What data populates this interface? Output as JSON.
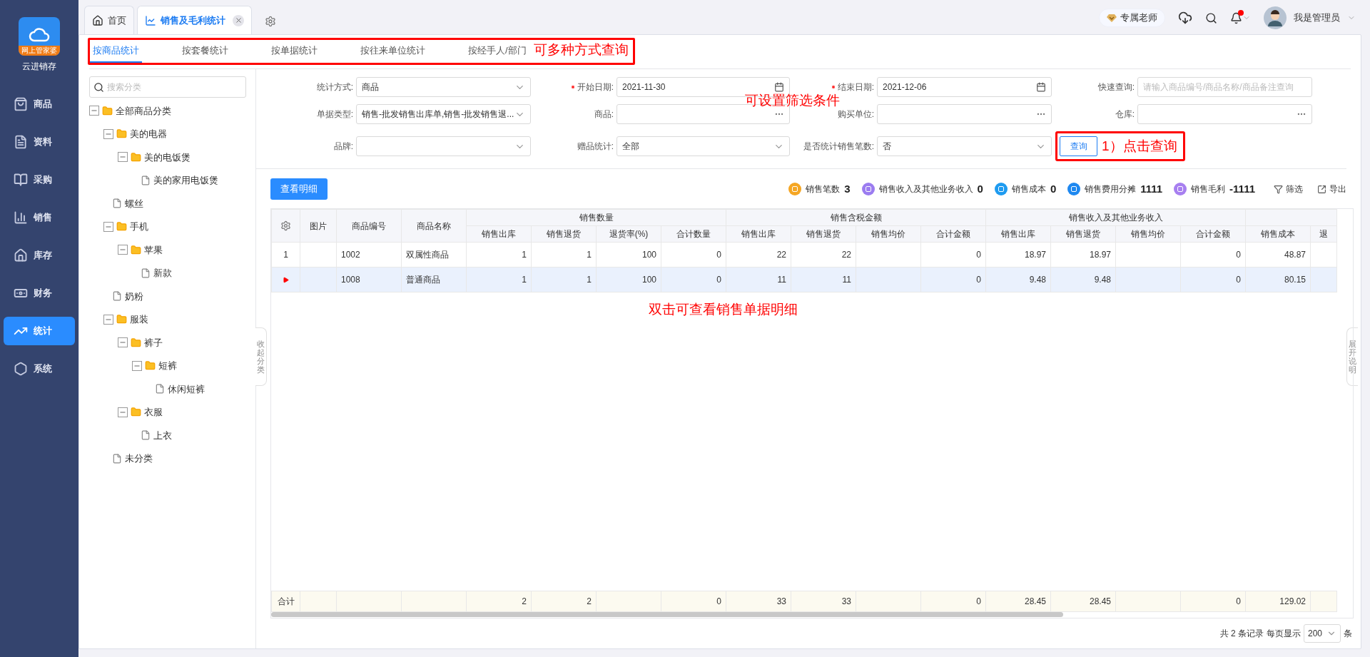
{
  "sidebar": {
    "logo_badge": "网上管家婆",
    "app_name": "云进销存",
    "items": [
      {
        "label": "商品",
        "selected": false
      },
      {
        "label": "资料",
        "selected": false
      },
      {
        "label": "采购",
        "selected": false
      },
      {
        "label": "销售",
        "selected": false
      },
      {
        "label": "库存",
        "selected": false
      },
      {
        "label": "财务",
        "selected": false
      },
      {
        "label": "统计",
        "selected": true
      },
      {
        "label": "系统",
        "selected": false
      }
    ]
  },
  "tabs": [
    {
      "label": "首页",
      "selected": false,
      "closable": false
    },
    {
      "label": "销售及毛利统计",
      "selected": true,
      "closable": true
    }
  ],
  "header": {
    "teacher": "专属老师",
    "user": "我是管理员",
    "has_notification": true
  },
  "sub_tabs": [
    {
      "label": "按商品统计",
      "selected": true
    },
    {
      "label": "按套餐统计",
      "selected": false
    },
    {
      "label": "按单据统计",
      "selected": false
    },
    {
      "label": "按往来单位统计",
      "selected": false
    },
    {
      "label": "按经手人/部门",
      "selected": false
    }
  ],
  "annotations": {
    "tabs_note": "可多种方式查询",
    "filter_note": "可设置筛选条件",
    "query_note": "1）点击查询",
    "table_note": "双击可查看销售单据明细"
  },
  "tree": {
    "placeholder": "搜索分类",
    "collapse_label": "收起分类",
    "nodes": [
      {
        "label": "全部商品分类",
        "kind": "folder",
        "expanded": true,
        "children": [
          {
            "label": "美的电器",
            "kind": "folder",
            "expanded": true,
            "children": [
              {
                "label": "美的电饭煲",
                "kind": "folder",
                "expanded": true,
                "children": [
                  {
                    "label": "美的家用电饭煲",
                    "kind": "file"
                  }
                ]
              }
            ]
          },
          {
            "label": "螺丝",
            "kind": "file"
          },
          {
            "label": "手机",
            "kind": "folder",
            "expanded": true,
            "children": [
              {
                "label": "苹果",
                "kind": "folder",
                "expanded": true,
                "children": [
                  {
                    "label": "新款",
                    "kind": "file"
                  }
                ]
              }
            ]
          },
          {
            "label": "奶粉",
            "kind": "file"
          },
          {
            "label": "服装",
            "kind": "folder",
            "expanded": true,
            "children": [
              {
                "label": "裤子",
                "kind": "folder",
                "expanded": true,
                "children": [
                  {
                    "label": "短裤",
                    "kind": "folder",
                    "expanded": true,
                    "children": [
                      {
                        "label": "休闲短裤",
                        "kind": "file"
                      }
                    ]
                  }
                ]
              },
              {
                "label": "衣服",
                "kind": "folder",
                "expanded": true,
                "children": [
                  {
                    "label": "上衣",
                    "kind": "file"
                  }
                ]
              }
            ]
          },
          {
            "label": "未分类",
            "kind": "file"
          }
        ]
      }
    ]
  },
  "filters": [
    [
      {
        "label": "统计方式:",
        "kind": "select",
        "value": "商品"
      },
      {
        "label": "开始日期:",
        "kind": "date",
        "value": "2021-11-30",
        "required": true
      },
      {
        "label": "结束日期:",
        "kind": "date",
        "value": "2021-12-06",
        "required": true
      },
      {
        "label": "快速查询:",
        "kind": "text",
        "placeholder": "请输入商品编号/商品名称/商品备注查询"
      }
    ],
    [
      {
        "label": "单据类型:",
        "kind": "select",
        "value": "销售-批发销售出库单,销售-批发销售退..."
      },
      {
        "label": "商品:",
        "kind": "picker"
      },
      {
        "label": "购买单位:",
        "kind": "picker"
      },
      {
        "label": "仓库:",
        "kind": "picker"
      }
    ],
    [
      {
        "label": "品牌:",
        "kind": "select"
      },
      {
        "label": "赠品统计:",
        "kind": "select",
        "value": "全部"
      },
      {
        "label": "是否统计销售笔数:",
        "kind": "select",
        "value": "否"
      }
    ]
  ],
  "query_button": "查询",
  "detail_button": "查看明细",
  "stats": [
    {
      "label": "销售笔数",
      "value": "3",
      "color": "#f5a623"
    },
    {
      "label": "销售收入及其他业务收入",
      "value": "0",
      "color": "#9b7cf0"
    },
    {
      "label": "销售成本",
      "value": "0",
      "color": "#1e9bf0"
    },
    {
      "label": "销售费用分摊",
      "value": "1111",
      "color": "#1e88f0"
    },
    {
      "label": "销售毛利",
      "value": "-1111",
      "color": "#a77ff0"
    }
  ],
  "tools": [
    "筛选",
    "导出"
  ],
  "table": {
    "groups": [
      "销售数量",
      "销售含税金额",
      "销售收入及其他业务收入"
    ],
    "columns": [
      "图片",
      "商品编号",
      "商品名称",
      "销售出库",
      "销售退货",
      "退货率(%)",
      "合计数量",
      "销售出库",
      "销售退货",
      "销售均价",
      "合计金额",
      "销售出库",
      "销售退货",
      "销售均价",
      "合计金额",
      "销售成本",
      "退"
    ],
    "rows": [
      {
        "index": "1",
        "selected": false,
        "cells": [
          "",
          "1002",
          "双属性商品",
          "1",
          "1",
          "100",
          "0",
          "22",
          "22",
          "",
          "0",
          "18.97",
          "18.97",
          "",
          "0",
          "48.87",
          ""
        ]
      },
      {
        "selected": true,
        "cells": [
          "",
          "1008",
          "普通商品",
          "1",
          "1",
          "100",
          "0",
          "11",
          "11",
          "",
          "0",
          "9.48",
          "9.48",
          "",
          "0",
          "80.15",
          ""
        ]
      }
    ],
    "totals": {
      "label": "合计",
      "cells": [
        "",
        "",
        "",
        "2",
        "2",
        "",
        "0",
        "33",
        "33",
        "",
        "0",
        "28.45",
        "28.45",
        "",
        "0",
        "129.02",
        ""
      ]
    }
  },
  "pagination": {
    "summary": "共 2 条记录",
    "per_page_label": "每页显示",
    "per_page": "200",
    "unit": "条"
  },
  "side_handle": "展开说明"
}
